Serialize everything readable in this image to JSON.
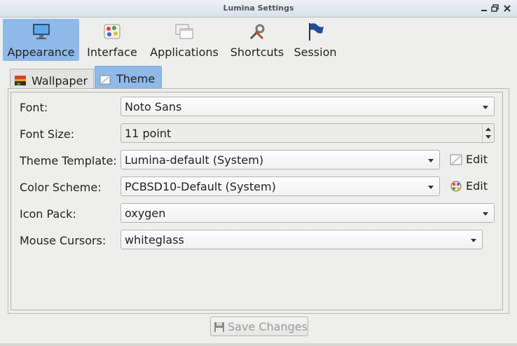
{
  "window": {
    "title": "Lumina Settings"
  },
  "toolbar": {
    "items": [
      {
        "label": "Appearance",
        "icon": "monitor-icon",
        "active": true
      },
      {
        "label": "Interface",
        "icon": "palette-icon",
        "active": false
      },
      {
        "label": "Applications",
        "icon": "windows-icon",
        "active": false
      },
      {
        "label": "Shortcuts",
        "icon": "tools-icon",
        "active": false
      },
      {
        "label": "Session",
        "icon": "flag-icon",
        "active": false
      }
    ]
  },
  "tabs": [
    {
      "label": "Wallpaper",
      "icon": "image-icon",
      "active": false
    },
    {
      "label": "Theme",
      "icon": "theme-icon",
      "active": true
    }
  ],
  "form": {
    "font": {
      "label": "Font:",
      "value": "Noto Sans"
    },
    "font_size": {
      "label": "Font Size:",
      "value": "11 point"
    },
    "theme_template": {
      "label": "Theme Template:",
      "value": "Lumina-default (System)",
      "edit_label": "Edit"
    },
    "color_scheme": {
      "label": "Color Scheme:",
      "value": "PCBSD10-Default (System)",
      "edit_label": "Edit"
    },
    "icon_pack": {
      "label": "Icon Pack:",
      "value": "oxygen"
    },
    "mouse_cursors": {
      "label": "Mouse Cursors:",
      "value": "whiteglass"
    }
  },
  "footer": {
    "save_label": "Save Changes",
    "save_icon": "floppy-icon"
  },
  "colors": {
    "accent": "#8fb9e8",
    "window_bg": "#eeeeec"
  }
}
